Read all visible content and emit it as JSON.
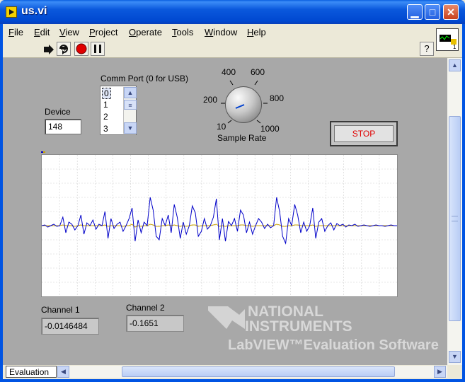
{
  "window": {
    "title": "us.vi"
  },
  "menu": [
    {
      "label": "File",
      "u": "F",
      "rest": "ile"
    },
    {
      "label": "Edit",
      "u": "E",
      "rest": "dit"
    },
    {
      "label": "View",
      "u": "V",
      "rest": "iew"
    },
    {
      "label": "Project",
      "u": "P",
      "rest": "roject"
    },
    {
      "label": "Operate",
      "u": "O",
      "rest": "perate"
    },
    {
      "label": "Tools",
      "u": "T",
      "rest": "ools"
    },
    {
      "label": "Window",
      "u": "W",
      "rest": "indow"
    },
    {
      "label": "Help",
      "u": "H",
      "rest": "elp"
    }
  ],
  "toolbar": {
    "buttons": [
      "run-arrow-icon",
      "run-continuously-icon",
      "abort-icon",
      "pause-icon"
    ],
    "help_label": "?"
  },
  "vi_icon_label": "1",
  "device": {
    "label": "Device",
    "value": "148"
  },
  "comm_port": {
    "label": "Comm Port (0 for USB)",
    "items": [
      "0",
      "1",
      "2",
      "3"
    ],
    "selected": "0"
  },
  "sample_rate": {
    "label": "Sample Rate",
    "ticks": [
      "10",
      "200",
      "400",
      "600",
      "800",
      "1000"
    ],
    "value": 200
  },
  "stop_button": {
    "label": "STOP"
  },
  "channel1": {
    "label": "Channel 1",
    "value": "-0.0146484"
  },
  "channel2": {
    "label": "Channel 2",
    "value": "-0.1651"
  },
  "watermark": {
    "line1": "NATIONAL",
    "line2": "INSTRUMENTS",
    "line3": "LabVIEW™Evaluation Software"
  },
  "status": {
    "tab_label": "Evaluation"
  },
  "colors": {
    "trace1": "#0000c8",
    "trace2": "#c8a000",
    "grid": "#cfcfcf",
    "stop_text": "#e00000"
  },
  "chart_data": {
    "type": "line",
    "grid": true,
    "ylim": [
      -1,
      1
    ],
    "series": [
      {
        "values": [
          0.0,
          0.01,
          -0.02,
          0.0,
          0.02,
          -0.01,
          0.0,
          0.12,
          -0.1,
          0.05,
          0.02,
          -0.06,
          0.0,
          0.15,
          -0.12,
          0.04,
          0.0,
          0.08,
          -0.05,
          0.02,
          0.0,
          0.2,
          -0.18,
          0.1,
          -0.04,
          0.02,
          0.05,
          -0.08,
          0.0,
          0.1,
          0.25,
          -0.22,
          0.08,
          -0.1,
          0.05,
          0.0,
          0.4,
          0.22,
          -0.15,
          -0.2,
          0.1,
          0.0,
          0.15,
          -0.1,
          0.3,
          0.12,
          -0.18,
          0.05,
          -0.12,
          0.0,
          0.28,
          0.18,
          -0.15,
          -0.08,
          0.1,
          -0.05,
          0.0,
          0.12,
          0.38,
          -0.2,
          0.1,
          -0.22,
          0.06,
          0.0,
          0.1,
          -0.08,
          0.22,
          0.15,
          -0.1,
          0.05,
          -0.12,
          0.0,
          0.1,
          0.05,
          -0.04,
          0.02,
          -0.03,
          0.0,
          0.4,
          0.2,
          -0.15,
          -0.25,
          0.1,
          0.0,
          0.3,
          0.15,
          -0.1,
          0.05,
          -0.08,
          0.0,
          0.25,
          -0.18,
          0.05,
          0.1,
          -0.08,
          0.0,
          0.04,
          -0.06,
          0.03,
          0.0,
          0.02,
          -0.02,
          0.01,
          0.0,
          0.02,
          -0.01,
          0.0,
          0.01,
          0.0,
          -0.01,
          0.0,
          0.01,
          0.0,
          0.0,
          -0.01,
          0.0,
          0.01,
          0.0,
          0.0
        ]
      },
      {
        "values": [
          0.0,
          0.0,
          0.0,
          0.0,
          0.0,
          0.0,
          0.0,
          0.01,
          0.0,
          0.0,
          0.0,
          -0.01,
          0.0,
          0.01,
          0.0,
          0.0,
          0.0,
          0.0,
          0.0,
          0.0,
          0.0,
          0.01,
          -0.01,
          0.0,
          0.0,
          0.0,
          0.0,
          -0.01,
          0.0,
          0.0,
          0.02,
          -0.02,
          0.0,
          -0.01,
          0.0,
          0.0,
          0.02,
          0.01,
          -0.01,
          -0.01,
          0.0,
          0.0,
          0.01,
          0.0,
          0.01,
          0.0,
          -0.01,
          0.0,
          -0.01,
          0.0,
          0.01,
          0.01,
          -0.01,
          0.0,
          0.0,
          0.0,
          0.0,
          0.01,
          0.02,
          -0.01,
          0.0,
          -0.01,
          0.0,
          0.0,
          0.0,
          0.0,
          0.01,
          0.01,
          0.0,
          0.0,
          -0.01,
          0.0,
          0.0,
          0.0,
          0.0,
          0.0,
          0.0,
          0.0,
          0.02,
          0.01,
          -0.01,
          -0.01,
          0.0,
          0.0,
          0.01,
          0.01,
          0.0,
          0.0,
          0.0,
          0.0,
          0.01,
          -0.01,
          0.0,
          0.0,
          0.0,
          0.0,
          0.0,
          0.0,
          0.0,
          0.0,
          0.0,
          0.0,
          0.0,
          0.0,
          0.0,
          0.0,
          0.0,
          0.0,
          0.0,
          0.0,
          0.0,
          0.0,
          0.0,
          0.0,
          0.0,
          0.0,
          0.0,
          0.0,
          0.0
        ]
      }
    ]
  }
}
